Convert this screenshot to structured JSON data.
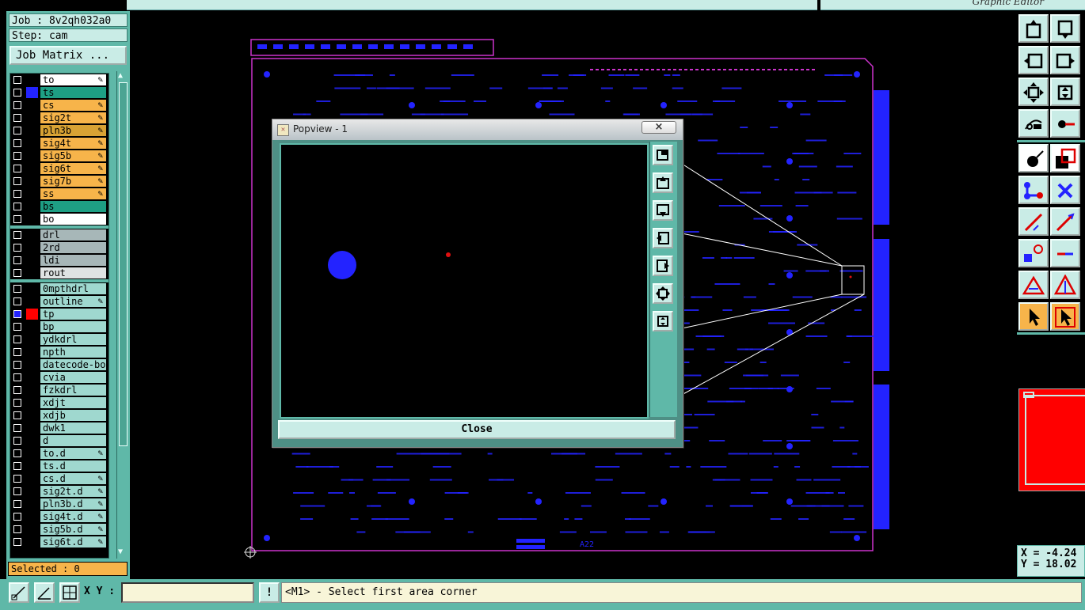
{
  "app": {
    "title": "Graphic Editor"
  },
  "job": {
    "job_label": "Job : 8v2qh032a0",
    "step_label": "Step: cam",
    "matrix_button": "Job Matrix ..."
  },
  "layers": {
    "groups": [
      [
        {
          "name": "to",
          "color": "#ffffff",
          "swatch": "#000000",
          "edit": true
        },
        {
          "name": "ts",
          "color": "#1e9f84",
          "swatch": "#2323ff",
          "edit": false
        },
        {
          "name": "cs",
          "color": "#f7b44a",
          "swatch": "#000000",
          "edit": true
        },
        {
          "name": "sig2t",
          "color": "#f7b44a",
          "swatch": "#000000",
          "edit": true
        },
        {
          "name": "pln3b",
          "color": "#d8a234",
          "swatch": "#000000",
          "edit": true
        },
        {
          "name": "sig4t",
          "color": "#f7b44a",
          "swatch": "#000000",
          "edit": true
        },
        {
          "name": "sig5b",
          "color": "#f7b44a",
          "swatch": "#000000",
          "edit": true
        },
        {
          "name": "sig6t",
          "color": "#f7b44a",
          "swatch": "#000000",
          "edit": true
        },
        {
          "name": "sig7b",
          "color": "#f7b44a",
          "swatch": "#000000",
          "edit": true
        },
        {
          "name": "ss",
          "color": "#f7b44a",
          "swatch": "#000000",
          "edit": true
        },
        {
          "name": "bs",
          "color": "#1e9f84",
          "swatch": "#000000",
          "edit": false
        },
        {
          "name": "bo",
          "color": "#ffffff",
          "swatch": "#000000",
          "edit": false
        }
      ],
      [
        {
          "name": "drl",
          "color": "#a7b7b8",
          "swatch": "#000000",
          "edit": false
        },
        {
          "name": "2rd",
          "color": "#a7b7b8",
          "swatch": "#000000",
          "edit": false
        },
        {
          "name": "ldi",
          "color": "#a7b7b8",
          "swatch": "#000000",
          "edit": false
        },
        {
          "name": "rout",
          "color": "#dfe3e3",
          "swatch": "#000000",
          "edit": false
        }
      ],
      [
        {
          "name": "0mpthdrl",
          "color": "#9fd8cf",
          "swatch": "#000000",
          "edit": false
        },
        {
          "name": "outline",
          "color": "#9fd8cf",
          "swatch": "#000000",
          "edit": true
        },
        {
          "name": "tp",
          "color": "#9fd8cf",
          "swatch": "#ff0000",
          "edit": false,
          "checked": true
        },
        {
          "name": "bp",
          "color": "#9fd8cf",
          "swatch": "#000000",
          "edit": false
        },
        {
          "name": "ydkdrl",
          "color": "#9fd8cf",
          "swatch": "#000000",
          "edit": false
        },
        {
          "name": "npth",
          "color": "#9fd8cf",
          "swatch": "#000000",
          "edit": false
        },
        {
          "name": "datecode-bo",
          "color": "#9fd8cf",
          "swatch": "#000000",
          "edit": false
        },
        {
          "name": "cvia",
          "color": "#9fd8cf",
          "swatch": "#000000",
          "edit": false
        },
        {
          "name": "fzkdrl",
          "color": "#9fd8cf",
          "swatch": "#000000",
          "edit": false
        },
        {
          "name": "xdjt",
          "color": "#9fd8cf",
          "swatch": "#000000",
          "edit": false
        },
        {
          "name": "xdjb",
          "color": "#9fd8cf",
          "swatch": "#000000",
          "edit": false
        },
        {
          "name": "dwk1",
          "color": "#9fd8cf",
          "swatch": "#000000",
          "edit": false
        },
        {
          "name": "d",
          "color": "#9fd8cf",
          "swatch": "#000000",
          "edit": false
        },
        {
          "name": "to.d",
          "color": "#9fd8cf",
          "swatch": "#000000",
          "edit": true
        },
        {
          "name": "ts.d",
          "color": "#9fd8cf",
          "swatch": "#000000",
          "edit": false
        },
        {
          "name": "cs.d",
          "color": "#9fd8cf",
          "swatch": "#000000",
          "edit": true
        },
        {
          "name": "sig2t.d",
          "color": "#9fd8cf",
          "swatch": "#000000",
          "edit": true
        },
        {
          "name": "pln3b.d",
          "color": "#9fd8cf",
          "swatch": "#000000",
          "edit": true
        },
        {
          "name": "sig4t.d",
          "color": "#9fd8cf",
          "swatch": "#000000",
          "edit": true
        },
        {
          "name": "sig5b.d",
          "color": "#9fd8cf",
          "swatch": "#000000",
          "edit": true
        },
        {
          "name": "sig6t.d",
          "color": "#9fd8cf",
          "swatch": "#000000",
          "edit": true
        }
      ]
    ]
  },
  "status": {
    "selected": "Selected : 0"
  },
  "board": {
    "label": "A22",
    "outline_color": "#cc33cc",
    "pad_color": "#2323ff"
  },
  "popview": {
    "title": "Popview - 1",
    "close_x": "×",
    "close_button": "Close",
    "canvas_bg": "#000000"
  },
  "coords": {
    "x": "X = -4.24",
    "y": "Y = 18.02"
  },
  "bottom": {
    "xy_label": "X Y :",
    "xy_value": "",
    "hint_button": "!",
    "prompt": "<M1> - Select first area corner"
  },
  "colors": {
    "accent": "#5fb8a8",
    "panel": "#c9ece6",
    "highlight": "#f7b44a"
  }
}
